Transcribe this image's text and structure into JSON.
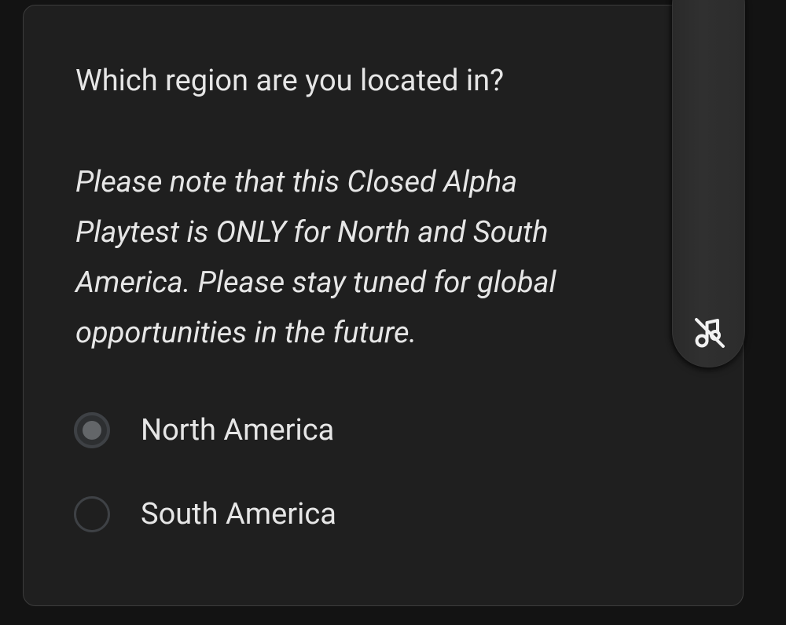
{
  "form": {
    "question": "Which region are you located in?",
    "note_lines": [
      "Please note that this Closed Alpha",
      "Playtest is ONLY for North and South",
      "America. Please stay tuned for global",
      "opportunities in the future."
    ],
    "options": [
      {
        "label": "North America",
        "selected": true
      },
      {
        "label": "South America",
        "selected": false
      }
    ]
  },
  "side_panel": {
    "icon": "music-off-icon"
  },
  "colors": {
    "page_background": "#131313",
    "card_background": "#1f1f1f",
    "card_border": "#3c3c3c",
    "text": "#e6e6e6",
    "radio_border": "#3e4145",
    "radio_dot": "#636669"
  }
}
